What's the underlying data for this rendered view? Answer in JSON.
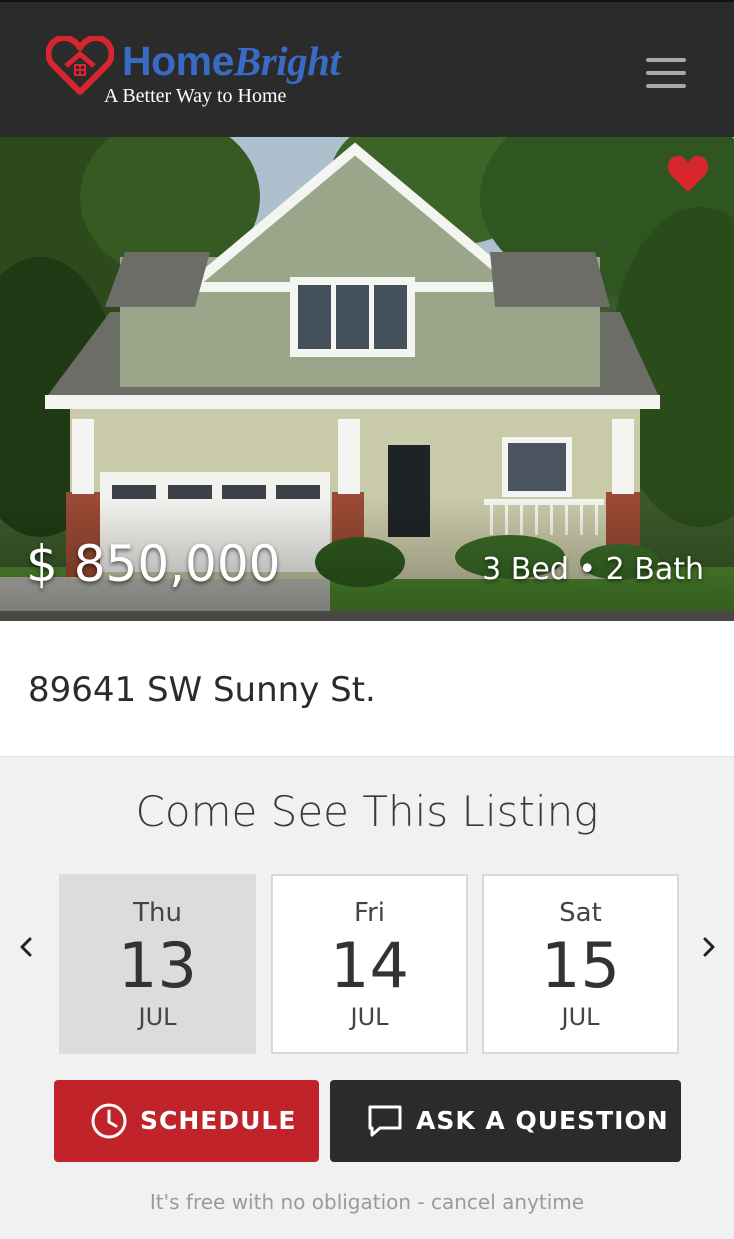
{
  "header": {
    "brand_home": "Home",
    "brand_bright": "Bright",
    "tagline": "A Better Way to Home",
    "menu_icon": "hamburger-menu-icon"
  },
  "colors": {
    "header_bg": "#2b2b2b",
    "brand_blue": "#3a6bc4",
    "brand_red": "#d8262e",
    "schedule_red": "#c0242a",
    "ask_dark": "#2b2b2b",
    "selected_day_bg": "#dcdcdc"
  },
  "listing": {
    "price": "$ 850,000",
    "beds_baths": "3 Bed • 2 Bath",
    "address": "89641 SW Sunny St.",
    "favorite_icon": "heart-icon",
    "favorited": true
  },
  "tour": {
    "title": "Come See This Listing",
    "days": [
      {
        "dow": "Thu",
        "day": "13",
        "month": "JUL",
        "selected": true
      },
      {
        "dow": "Fri",
        "day": "14",
        "month": "JUL",
        "selected": false
      },
      {
        "dow": "Sat",
        "day": "15",
        "month": "JUL",
        "selected": false
      }
    ],
    "prev_icon": "chevron-left-icon",
    "next_icon": "chevron-right-icon",
    "schedule_label": "SCHEDULE",
    "schedule_icon": "clock-icon",
    "ask_label": "ASK A QUESTION",
    "ask_icon": "chat-bubble-icon",
    "footnote": "It's free with no obligation - cancel anytime"
  }
}
